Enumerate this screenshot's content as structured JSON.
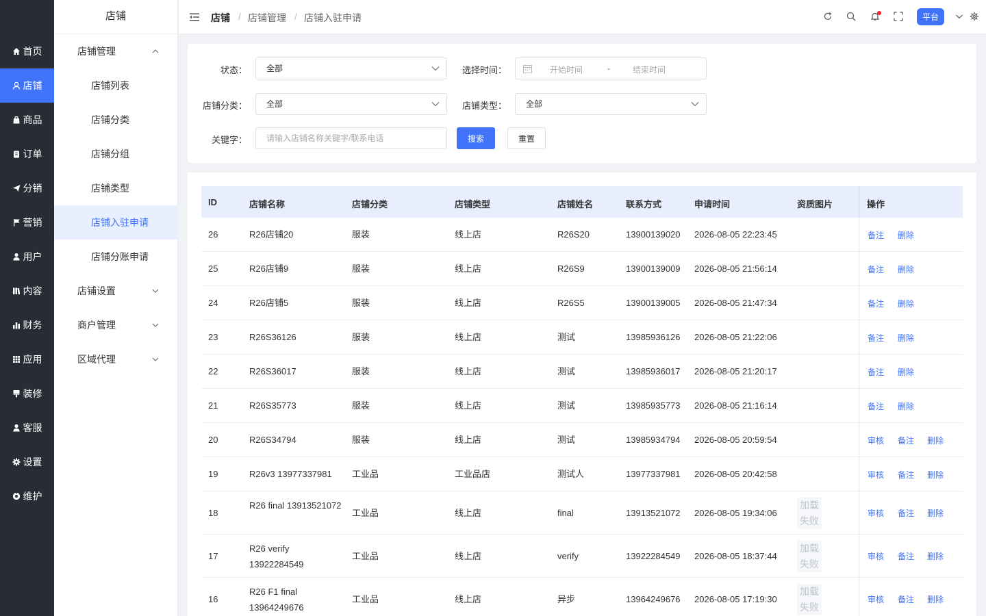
{
  "rail": [
    {
      "label": "首页",
      "icon": "home-icon"
    },
    {
      "label": "店铺",
      "icon": "user-icon"
    },
    {
      "label": "商品",
      "icon": "bag-icon"
    },
    {
      "label": "订单",
      "icon": "clipboard-icon"
    },
    {
      "label": "分销",
      "icon": "send-icon"
    },
    {
      "label": "营销",
      "icon": "flag-icon"
    },
    {
      "label": "用户",
      "icon": "person-icon"
    },
    {
      "label": "内容",
      "icon": "book-icon"
    },
    {
      "label": "财务",
      "icon": "bar-chart-icon"
    },
    {
      "label": "应用",
      "icon": "grid-icon"
    },
    {
      "label": "装修",
      "icon": "brush-icon"
    },
    {
      "label": "客服",
      "icon": "headset-icon"
    },
    {
      "label": "设置",
      "icon": "gear-icon"
    },
    {
      "label": "维护",
      "icon": "wrench-icon"
    }
  ],
  "submenu": {
    "title": "店铺",
    "group_main": "店铺管理",
    "items": [
      "店铺列表",
      "店铺分类",
      "店铺分组",
      "店铺类型",
      "店铺入驻申请",
      "店铺分账申请"
    ],
    "groups": [
      "店铺设置",
      "商户管理",
      "区域代理"
    ]
  },
  "header": {
    "breadcrumb": [
      "店铺",
      "店铺管理",
      "店铺入驻申请"
    ],
    "platform": "平台"
  },
  "filter": {
    "status_label": "状态：",
    "status_value": "全部",
    "time_label": "选择时间：",
    "start_placeholder": "开始时间",
    "range_sep": "-",
    "end_placeholder": "结束时间",
    "category_label": "店铺分类：",
    "category_value": "全部",
    "type_label": "店铺类型：",
    "type_value": "全部",
    "keyword_label": "关键字：",
    "keyword_placeholder": "请输入店铺名称关键字/联系电话",
    "search": "搜索",
    "reset": "重置"
  },
  "table": {
    "headers": [
      "ID",
      "店铺名称",
      "店铺分类",
      "店铺类型",
      "店铺姓名",
      "联系方式",
      "申请时间",
      "资质图片",
      "操作"
    ],
    "img_fail": "加载失败",
    "actions": {
      "audit": "审核",
      "remark": "备注",
      "delete": "删除"
    },
    "rows": [
      {
        "id": "26",
        "name": "R26店铺20",
        "category": "服装",
        "type": "线上店",
        "owner": "R26S20",
        "phone": "13900139020",
        "time": "2026-08-05 22:23:45"
      },
      {
        "id": "25",
        "name": "R26店铺9",
        "category": "服装",
        "type": "线上店",
        "owner": "R26S9",
        "phone": "13900139009",
        "time": "2026-08-05 21:56:14"
      },
      {
        "id": "24",
        "name": "R26店铺5",
        "category": "服装",
        "type": "线上店",
        "owner": "R26S5",
        "phone": "13900139005",
        "time": "2026-08-05 21:47:34"
      },
      {
        "id": "23",
        "name": "R26S36126",
        "category": "服装",
        "type": "线上店",
        "owner": "测试",
        "phone": "13985936126",
        "time": "2026-08-05 21:22:06"
      },
      {
        "id": "22",
        "name": "R26S36017",
        "category": "服装",
        "type": "线上店",
        "owner": "测试",
        "phone": "13985936017",
        "time": "2026-08-05 21:20:17"
      },
      {
        "id": "21",
        "name": "R26S35773",
        "category": "服装",
        "type": "线上店",
        "owner": "测试",
        "phone": "13985935773",
        "time": "2026-08-05 21:16:14"
      },
      {
        "id": "20",
        "name": "R26S34794",
        "category": "服装",
        "type": "线上店",
        "owner": "测试",
        "phone": "13985934794",
        "time": "2026-08-05 20:59:54"
      },
      {
        "id": "19",
        "name": "R26v3 13977337981",
        "category": "工业品",
        "type": "工业品店",
        "owner": "测试人",
        "phone": "13977337981",
        "time": "2026-08-05 20:42:58"
      },
      {
        "id": "18",
        "name": "R26 final 13913521072",
        "category": "工业品",
        "type": "线上店",
        "owner": "final",
        "phone": "13913521072",
        "time": "2026-08-05 19:34:06"
      },
      {
        "id": "17",
        "name": "R26 verify 13922284549",
        "category": "工业品",
        "type": "线上店",
        "owner": "verify",
        "phone": "13922284549",
        "time": "2026-08-05 18:37:44"
      },
      {
        "id": "16",
        "name": "R26 F1 final 13964249676",
        "category": "工业品",
        "type": "线上店",
        "owner": "异步",
        "phone": "13964249676",
        "time": "2026-08-05 17:19:30"
      }
    ]
  }
}
